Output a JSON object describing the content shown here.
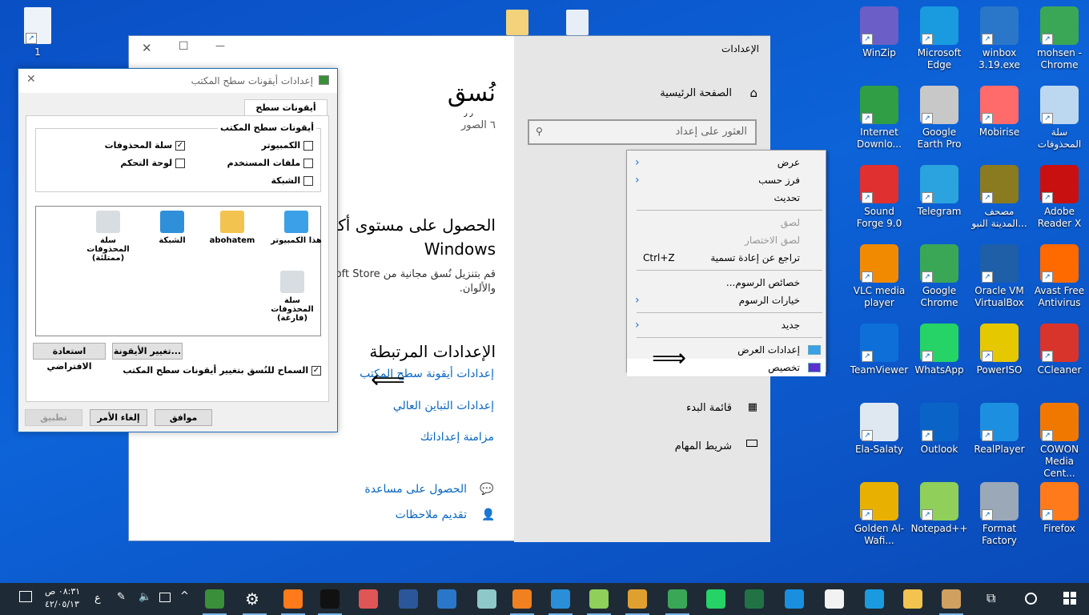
{
  "desktop": {
    "left_icons": [
      {
        "label": "1"
      }
    ],
    "right_icons": [
      {
        "label": "WinZip",
        "color": "#6b5fc7"
      },
      {
        "label": "Microsoft Edge",
        "color": "#1a9be0"
      },
      {
        "label": "winbox 3.19.exe",
        "color": "#2a77c9"
      },
      {
        "label": "mohsen - Chrome",
        "color": "#3aa757"
      },
      {
        "label": "Internet Downlo...",
        "color": "#2f9e44"
      },
      {
        "label": "Google Earth Pro",
        "color": "#c8c8c8"
      },
      {
        "label": "Mobirise",
        "color": "#ff6b6b"
      },
      {
        "label": "سلة المحذوفات",
        "color": "#bcd8f0"
      },
      {
        "label": "Sound Forge 9.0",
        "color": "#e03030"
      },
      {
        "label": "Telegram",
        "color": "#2aa3de"
      },
      {
        "label": "مصحف المدينة النبو...",
        "color": "#8a7a20"
      },
      {
        "label": "Adobe Reader X",
        "color": "#c81010"
      },
      {
        "label": "VLC media player",
        "color": "#f28a00"
      },
      {
        "label": "Google Chrome",
        "color": "#3aa757"
      },
      {
        "label": "Oracle VM VirtualBox",
        "color": "#1e5fa8"
      },
      {
        "label": "Avast Free Antivirus",
        "color": "#ff6a00"
      },
      {
        "label": "TeamViewer",
        "color": "#0e6fd8"
      },
      {
        "label": "WhatsApp",
        "color": "#25d366"
      },
      {
        "label": "PowerISO",
        "color": "#e6c800"
      },
      {
        "label": "CCleaner",
        "color": "#d9342b"
      },
      {
        "label": "Ela-Salaty",
        "color": "#dfe8f0"
      },
      {
        "label": "Outlook",
        "color": "#0a64c8"
      },
      {
        "label": "RealPlayer",
        "color": "#1d8fe0"
      },
      {
        "label": "COWON Media Cent...",
        "color": "#f07800"
      },
      {
        "label": "Golden Al-Wafi...",
        "color": "#e8b000"
      },
      {
        "label": "Notepad++",
        "color": "#8fcf5a"
      },
      {
        "label": "Format Factory",
        "color": "#9aa8b8"
      },
      {
        "label": "Firefox",
        "color": "#ff7a1a"
      }
    ]
  },
  "settings": {
    "window_controls": {
      "close": "✕",
      "maximize": "☐",
      "minimize": "—"
    },
    "nav_title": "الإعدادات",
    "home": "الصفحة الرئيسية",
    "search_placeholder": "العثور على إعداد",
    "nav_items": [
      {
        "label": "قائمة البدء",
        "icon": "start-icon"
      },
      {
        "label": "شريط المهام",
        "icon": "taskbar-icon"
      }
    ],
    "page_title": "نُسق",
    "page_title_sub": "ر ر",
    "themes_count": "٦ الصور",
    "get_more_title_1": "الحصول على مستوى أكبر",
    "get_more_title_2": "Windows",
    "get_more_desc_1": "قم بتنزيل نُسق مجانية من Microsoft Store",
    "get_more_desc_2": "والألوان.",
    "related_title": "الإعدادات المرتبطة",
    "related_links": [
      "إعدادات أيقونة سطح المكتب",
      "إعدادات التباين العالي",
      "مزامنة إعداداتك"
    ],
    "help": "الحصول على مساعدة",
    "feedback": "تقديم ملاحظات"
  },
  "dialog": {
    "title": "إعدادات أيقونات سطح المكتب",
    "tab": "أيقونات سطح المكتب",
    "group_label": "أيقونات سطح المكتب",
    "checkboxes": [
      {
        "label": "الكمبيوتر",
        "checked": false
      },
      {
        "label": "سلة المحذوفات",
        "checked": true
      },
      {
        "label": "ملفات المستخدم",
        "checked": false
      },
      {
        "label": "لوحة التحكم",
        "checked": false
      },
      {
        "label": "الشبكة",
        "checked": false
      }
    ],
    "preview_icons": [
      {
        "label": "هذا الكمبيوتر",
        "color": "#3ba0e8"
      },
      {
        "label": "abohatem",
        "color": "#f2c34e"
      },
      {
        "label": "الشبكة",
        "color": "#2f8fd8"
      },
      {
        "label": "سلة المحذوفات (ممتلئة)",
        "color": "#d8dde2"
      },
      {
        "label": "سلة المحذوفات (فارغة)",
        "color": "#d8dde2"
      }
    ],
    "change_icon": "تغيير الأيقونة...",
    "restore_default": "استعادة الافتراضي",
    "allow_themes": "السماح للنُسق بتغيير أيقونات سطح المكتب",
    "allow_themes_checked": true,
    "ok": "موافق",
    "cancel": "إلغاء الأمر",
    "apply": "تطبيق"
  },
  "context_menu": {
    "items": [
      {
        "label": "عرض",
        "submenu": true
      },
      {
        "label": "فرز حسب",
        "submenu": true
      },
      {
        "label": "تحديث"
      },
      {
        "sep": true
      },
      {
        "label": "لصق",
        "disabled": true
      },
      {
        "label": "لصق الاختصار",
        "disabled": true
      },
      {
        "label": "تراجع عن إعادة تسمية",
        "shortcut": "Ctrl+Z"
      },
      {
        "sep": true
      },
      {
        "label": "خصائص الرسوم..."
      },
      {
        "label": "خيارات الرسوم",
        "submenu": true
      },
      {
        "sep": true
      },
      {
        "label": "جديد",
        "submenu": true
      },
      {
        "sep": true
      },
      {
        "label": "إعدادات العرض",
        "icon": "display-icon"
      },
      {
        "label": "تخصيص",
        "icon": "personalize-icon",
        "highlighted": true
      }
    ]
  },
  "taskbar": {
    "time": "٠٨:٣١ ص",
    "date": "٤٢/٠٥/١٣",
    "language": "ع",
    "apps": [
      {
        "name": "display-settings",
        "color": "#3a8f3a",
        "running": true
      },
      {
        "name": "settings",
        "color": "#ffffff",
        "running": true
      },
      {
        "name": "firefox",
        "color": "#ff7a1a",
        "running": true
      },
      {
        "name": "speedtest",
        "color": "#111111",
        "running": true
      },
      {
        "name": "mobirise",
        "color": "#e05555",
        "running": false
      },
      {
        "name": "word",
        "color": "#2b579a",
        "running": false
      },
      {
        "name": "winbox",
        "color": "#2a77c9",
        "running": false
      },
      {
        "name": "notepad",
        "color": "#8fc8c8",
        "running": false
      },
      {
        "name": "media-player",
        "color": "#f08020",
        "running": true
      },
      {
        "name": "control-panel",
        "color": "#2a8fd8",
        "running": true
      },
      {
        "name": "notepad-plus",
        "color": "#8fcf5a",
        "running": true
      },
      {
        "name": "chrome-profile",
        "color": "#e0a030",
        "running": true
      },
      {
        "name": "chrome",
        "color": "#3aa757",
        "running": true
      },
      {
        "name": "whatsapp",
        "color": "#25d366",
        "running": false
      },
      {
        "name": "excel",
        "color": "#217346",
        "running": false
      },
      {
        "name": "mail",
        "color": "#1a8fe0",
        "running": false
      },
      {
        "name": "store",
        "color": "#f2f2f2",
        "running": false
      },
      {
        "name": "edge",
        "color": "#1a9be0",
        "running": false
      },
      {
        "name": "file-explorer",
        "color": "#f2c34e",
        "running": false
      },
      {
        "name": "paint",
        "color": "#d0a060",
        "running": true
      }
    ]
  }
}
